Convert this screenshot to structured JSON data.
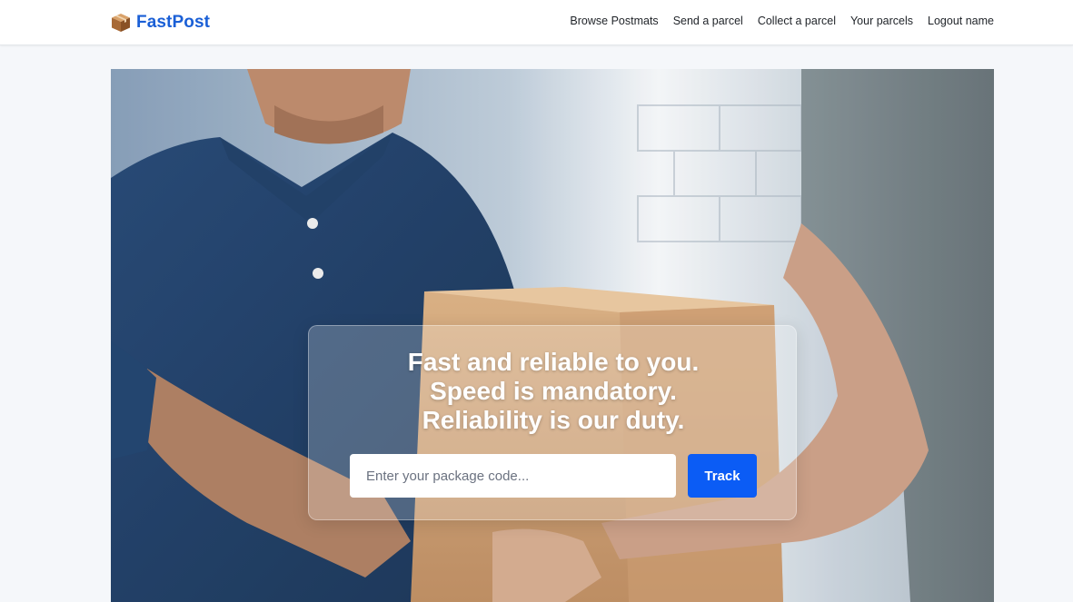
{
  "brand": {
    "name": "FastPost",
    "icon": "package-icon"
  },
  "nav": {
    "items": [
      {
        "label": "Browse Postmats"
      },
      {
        "label": "Send a parcel"
      },
      {
        "label": "Collect a parcel"
      },
      {
        "label": "Your parcels"
      },
      {
        "label": "Logout name"
      }
    ]
  },
  "hero": {
    "headline": [
      "Fast and reliable to you.",
      "Speed is mandatory.",
      "Reliability is our duty."
    ],
    "search": {
      "placeholder": "Enter your package code...",
      "value": ""
    },
    "track_label": "Track"
  },
  "colors": {
    "brand": "#1a5fd6",
    "accent": "#0b5cf5",
    "page_bg": "#f5f7fa"
  }
}
